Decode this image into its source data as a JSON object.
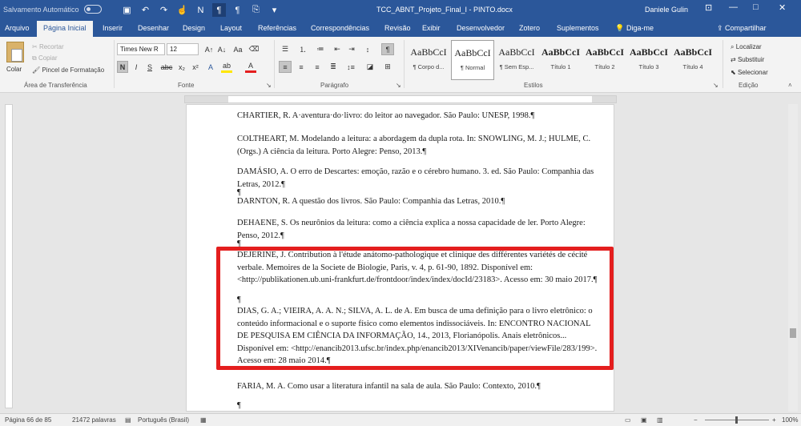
{
  "titlebar": {
    "autosave_label": "Salvamento Automático",
    "doc_title": "TCC_ABNT_Projeto_Final_I - PINTO.docx",
    "user": "Daniele Gulin",
    "qat": [
      "save-icon",
      "undo-icon",
      "redo-icon",
      "touch-icon",
      "pilcrow-icon",
      "pilcrow-icon",
      "pilcrow-icon",
      "format-icon",
      "customize-icon"
    ],
    "win_controls": [
      "—",
      "□",
      "✕"
    ]
  },
  "tabs": [
    "Arquivo",
    "Página Inicial",
    "Inserir",
    "Desenhar",
    "Design",
    "Layout",
    "Referências",
    "Correspondências",
    "Revisão",
    "Exibir",
    "Desenvolvedor",
    "Zotero",
    "Suplementos",
    "Diga-me"
  ],
  "share": "Compartilhar",
  "clipboard": {
    "paste": "Colar",
    "cut": "Recortar",
    "copy": "Copiar",
    "painter": "Pincel de Formatação",
    "label": "Área de Transferência"
  },
  "font": {
    "name": "Times New R",
    "size": "12",
    "label": "Fonte"
  },
  "paragraph": {
    "label": "Parágrafo"
  },
  "styles": {
    "label": "Estilos",
    "items": [
      {
        "preview": "AaBbCcI",
        "name": "¶ Corpo d..."
      },
      {
        "preview": "AaBbCcI",
        "name": "¶ Normal"
      },
      {
        "preview": "AaBbCcI",
        "name": "¶ Sem Esp..."
      },
      {
        "preview": "AaBbCcI",
        "name": "Título 1"
      },
      {
        "preview": "AaBbCcI",
        "name": "Título 2"
      },
      {
        "preview": "AaBbCcI",
        "name": "Título 3"
      },
      {
        "preview": "AaBbCcI",
        "name": "Título 4"
      }
    ]
  },
  "editing": {
    "find": "Localizar",
    "replace": "Substituir",
    "select": "Selecionar",
    "label": "Edição"
  },
  "document": {
    "refs": [
      "CHARTIER, R. A·aventura·do·livro: do leitor ao navegador. São Paulo: UNESP, 1998.¶",
      "COLTHEART, M. Modelando a leitura: a abordagem da dupla rota. In: SNOWLING, M. J.; HULME, C. (Orgs.) A ciência da leitura. Porto Alegre: Penso, 2013.¶",
      "DAMÁSIO, A. O erro de Descartes: emoção, razão e o cérebro humano. 3. ed. São Paulo: Companhia das Letras, 2012.¶",
      "DARNTON, R. A questão dos livros. São Paulo: Companhia das Letras, 2010.¶",
      "DEHAENE, S. Os neurônios da leitura: como a ciência explica a nossa capacidade de ler. Porto Alegre: Penso, 2012.¶",
      "DEJERINE, J. Contribution à l'étude anátomo-pathologique et clinique des différentes variétés de cécité verbale. Memoires de la Societe de Biologie, Paris, v. 4, p. 61-90, 1892. Disponível em: <http://publikationen.ub.uni-frankfurt.de/frontdoor/index/index/docId/23183>. Acesso em: 30 maio 2017.¶",
      "DIAS, G. A.; VIEIRA, A. A. N.; SILVA, A. L. de A. Em busca de uma definição para o livro eletrônico: o conteúdo informacional e o suporte físico como elementos indissociáveis. In: ENCONTRO NACIONAL DE PESQUISA EM CIÊNCIA DA INFORMAÇÃO, 14., 2013, Florianópolis. Anais eletrônicos... Disponível em: <http://enancib2013.ufsc.br/index.php/enancib2013/XIVenancib/paper/viewFile/283/199>. Acesso em: 28 maio 2014.¶",
      "FARIA, M. A. Como usar a literatura infantil na sala de aula. São Paulo: Contexto, 2010.¶"
    ],
    "pilcrow": "¶"
  },
  "status": {
    "page": "Página 66 de 85",
    "words": "21472 palavras",
    "language": "Português (Brasil)",
    "zoom": "100%"
  },
  "colors": {
    "word_blue": "#2b579a",
    "highlight": "#e41e1e"
  }
}
